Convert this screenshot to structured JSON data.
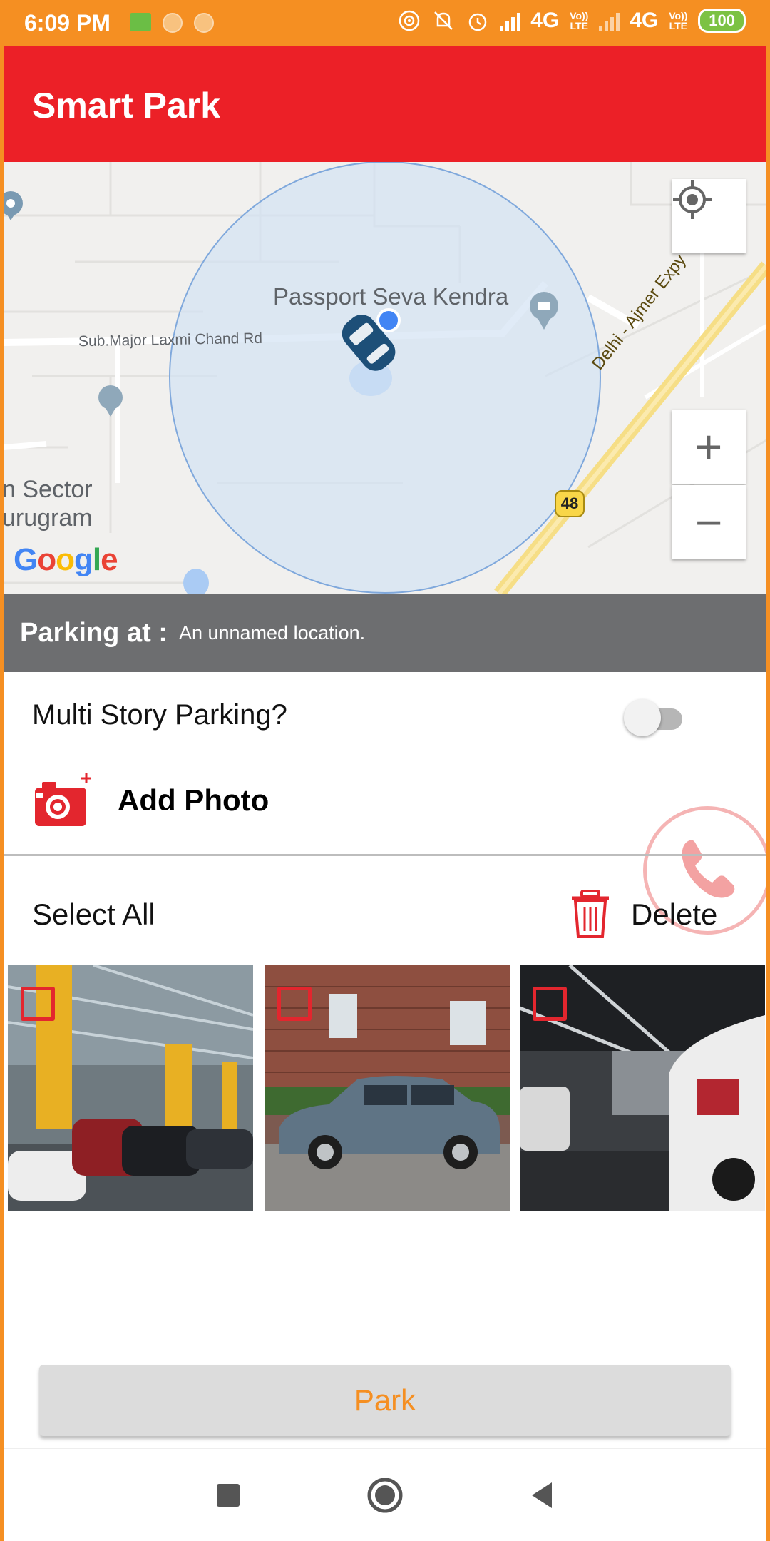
{
  "status_bar": {
    "time": "6:09 PM",
    "network_1": "4G",
    "network_2": "4G",
    "volte_1": "Vo)) LTE",
    "volte_2": "Vo)) LTE",
    "battery": "100"
  },
  "app_bar": {
    "title": "Smart Park"
  },
  "map": {
    "labels": {
      "passport_seva": "Passport Seva Kendra",
      "road_laxmi": "Sub.Major Laxmi Chand Rd",
      "highway": "Delhi - Ajmer Expy",
      "sector": "n Sector",
      "gurugram": "urugram",
      "highway_shield": "48"
    },
    "google_logo": [
      "G",
      "o",
      "o",
      "g",
      "l",
      "e"
    ],
    "zoom_in": "+",
    "zoom_out": "−",
    "icons": [
      "my-location-icon",
      "car-marker-icon",
      "landmark-pin-icon",
      "place-pin-icon"
    ]
  },
  "parking": {
    "label": "Parking at :",
    "value": "An unnamed location."
  },
  "multi_story": {
    "label": "Multi Story Parking?",
    "enabled": false
  },
  "photo": {
    "add_label": "Add Photo"
  },
  "selection": {
    "select_all": "Select All",
    "delete": "Delete"
  },
  "thumbnails": [
    {
      "name": "parking-garage-yellow-pillars",
      "checked": false
    },
    {
      "name": "grey-sedan-brick-wall",
      "checked": false
    },
    {
      "name": "underground-parking-white-car",
      "checked": false
    }
  ],
  "park_button": "Park",
  "colors": {
    "status_bar": "#F58F22",
    "app_bar": "#EC2027",
    "parking_bar": "#6D6E70",
    "accent": "#F58F22",
    "danger": "#E3262E"
  },
  "nav": [
    "recents-button",
    "home-button",
    "back-button"
  ]
}
